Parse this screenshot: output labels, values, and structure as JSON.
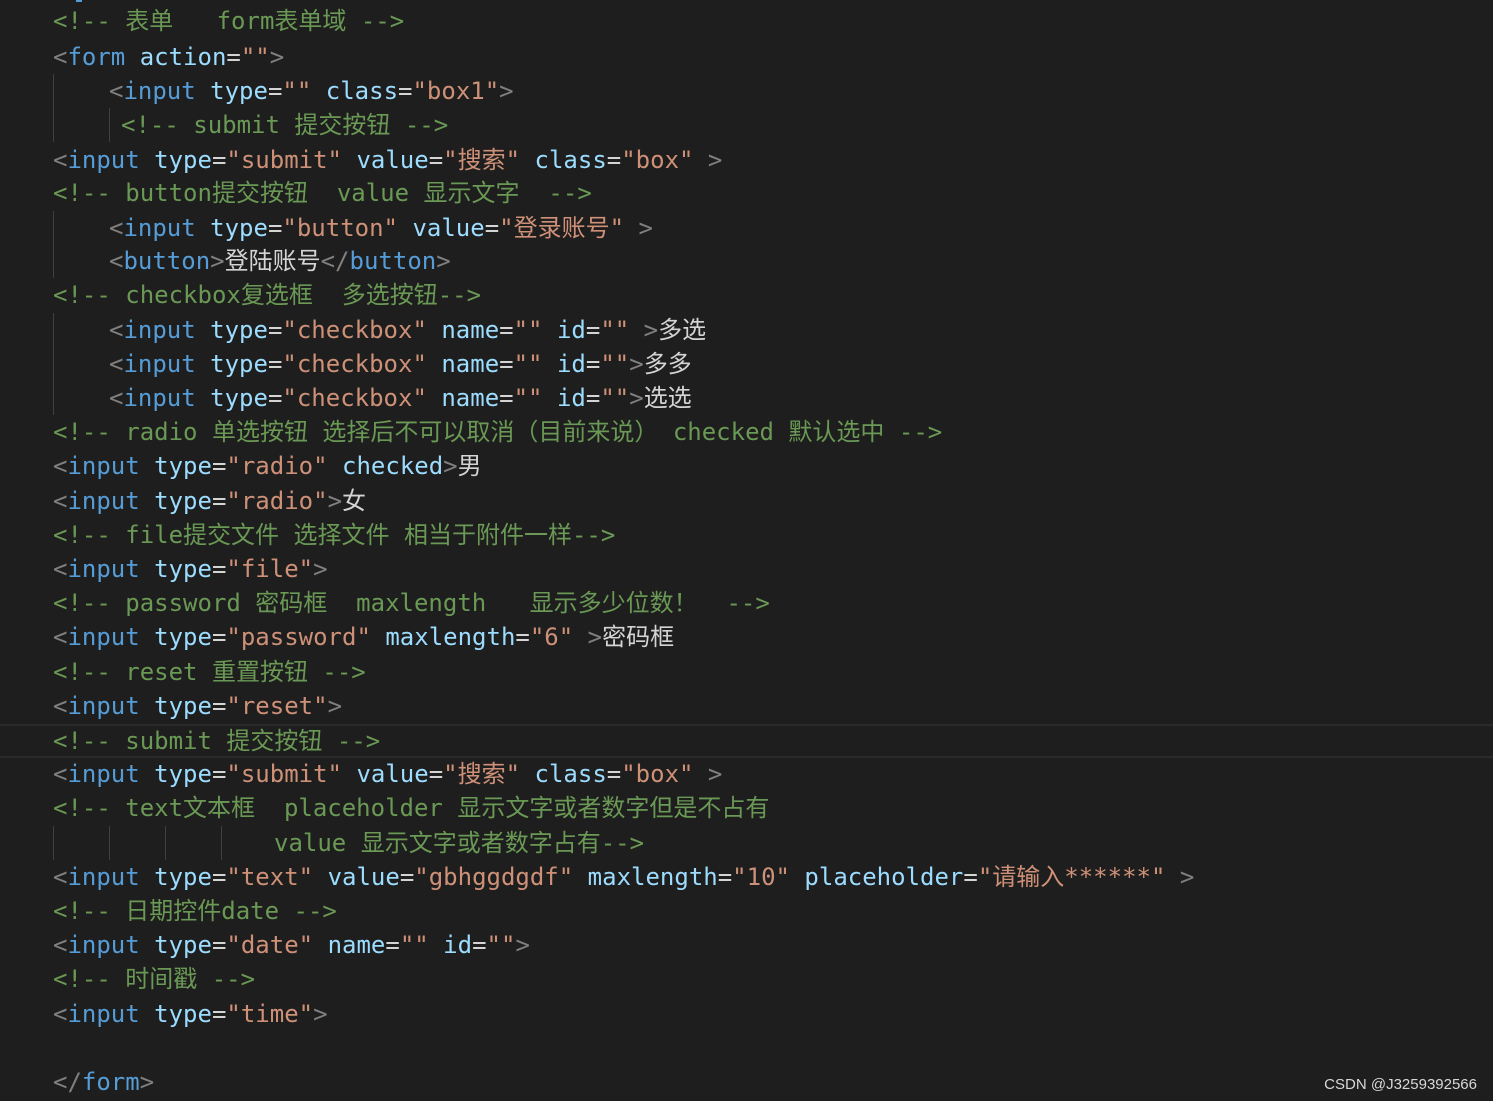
{
  "editor": {
    "language": "html",
    "lines": [
      {
        "tokens": [
          {
            "t": "<!-- 表单   form表单域 -->",
            "c": "com"
          }
        ]
      },
      {
        "tokens": [
          {
            "t": "<",
            "c": "pun"
          },
          {
            "t": "form",
            "c": "tag"
          },
          {
            "t": " ",
            "c": "txt"
          },
          {
            "t": "action",
            "c": "attr"
          },
          {
            "t": "=",
            "c": "eq"
          },
          {
            "t": "\"\"",
            "c": "str"
          },
          {
            "t": ">",
            "c": "pun"
          }
        ]
      },
      {
        "tokens": [
          {
            "t": "<",
            "c": "pun"
          },
          {
            "t": "input",
            "c": "tag"
          },
          {
            "t": " ",
            "c": "txt"
          },
          {
            "t": "type",
            "c": "attr"
          },
          {
            "t": "=",
            "c": "eq"
          },
          {
            "t": "\"\"",
            "c": "str"
          },
          {
            "t": " ",
            "c": "txt"
          },
          {
            "t": "class",
            "c": "attr"
          },
          {
            "t": "=",
            "c": "eq"
          },
          {
            "t": "\"box1\"",
            "c": "str"
          },
          {
            "t": ">",
            "c": "pun"
          }
        ]
      },
      {
        "tokens": [
          {
            "t": "<!-- submit 提交按钮 -->",
            "c": "com"
          }
        ]
      },
      {
        "tokens": [
          {
            "t": "<",
            "c": "pun"
          },
          {
            "t": "input",
            "c": "tag"
          },
          {
            "t": " ",
            "c": "txt"
          },
          {
            "t": "type",
            "c": "attr"
          },
          {
            "t": "=",
            "c": "eq"
          },
          {
            "t": "\"submit\"",
            "c": "str"
          },
          {
            "t": " ",
            "c": "txt"
          },
          {
            "t": "value",
            "c": "attr"
          },
          {
            "t": "=",
            "c": "eq"
          },
          {
            "t": "\"搜索\"",
            "c": "str"
          },
          {
            "t": " ",
            "c": "txt"
          },
          {
            "t": "class",
            "c": "attr"
          },
          {
            "t": "=",
            "c": "eq"
          },
          {
            "t": "\"box\"",
            "c": "str"
          },
          {
            "t": " >",
            "c": "pun"
          }
        ]
      },
      {
        "tokens": [
          {
            "t": "<!-- button提交按钮  value 显示文字  -->",
            "c": "com"
          }
        ]
      },
      {
        "tokens": [
          {
            "t": "<",
            "c": "pun"
          },
          {
            "t": "input",
            "c": "tag"
          },
          {
            "t": " ",
            "c": "txt"
          },
          {
            "t": "type",
            "c": "attr"
          },
          {
            "t": "=",
            "c": "eq"
          },
          {
            "t": "\"button\"",
            "c": "str"
          },
          {
            "t": " ",
            "c": "txt"
          },
          {
            "t": "value",
            "c": "attr"
          },
          {
            "t": "=",
            "c": "eq"
          },
          {
            "t": "\"登录账号\"",
            "c": "str"
          },
          {
            "t": " >",
            "c": "pun"
          }
        ]
      },
      {
        "tokens": [
          {
            "t": "<",
            "c": "pun"
          },
          {
            "t": "button",
            "c": "tag"
          },
          {
            "t": ">",
            "c": "pun"
          },
          {
            "t": "登陆账号",
            "c": "txt"
          },
          {
            "t": "</",
            "c": "pun"
          },
          {
            "t": "button",
            "c": "tag"
          },
          {
            "t": ">",
            "c": "pun"
          }
        ]
      },
      {
        "tokens": [
          {
            "t": "<!-- checkbox复选框  多选按钮-->",
            "c": "com"
          }
        ]
      },
      {
        "tokens": [
          {
            "t": "<",
            "c": "pun"
          },
          {
            "t": "input",
            "c": "tag"
          },
          {
            "t": " ",
            "c": "txt"
          },
          {
            "t": "type",
            "c": "attr"
          },
          {
            "t": "=",
            "c": "eq"
          },
          {
            "t": "\"checkbox\"",
            "c": "str"
          },
          {
            "t": " ",
            "c": "txt"
          },
          {
            "t": "name",
            "c": "attr"
          },
          {
            "t": "=",
            "c": "eq"
          },
          {
            "t": "\"\"",
            "c": "str"
          },
          {
            "t": " ",
            "c": "txt"
          },
          {
            "t": "id",
            "c": "attr"
          },
          {
            "t": "=",
            "c": "eq"
          },
          {
            "t": "\"\"",
            "c": "str"
          },
          {
            "t": " >",
            "c": "pun"
          },
          {
            "t": "多选",
            "c": "txt"
          }
        ]
      },
      {
        "tokens": [
          {
            "t": "<",
            "c": "pun"
          },
          {
            "t": "input",
            "c": "tag"
          },
          {
            "t": " ",
            "c": "txt"
          },
          {
            "t": "type",
            "c": "attr"
          },
          {
            "t": "=",
            "c": "eq"
          },
          {
            "t": "\"checkbox\"",
            "c": "str"
          },
          {
            "t": " ",
            "c": "txt"
          },
          {
            "t": "name",
            "c": "attr"
          },
          {
            "t": "=",
            "c": "eq"
          },
          {
            "t": "\"\"",
            "c": "str"
          },
          {
            "t": " ",
            "c": "txt"
          },
          {
            "t": "id",
            "c": "attr"
          },
          {
            "t": "=",
            "c": "eq"
          },
          {
            "t": "\"\"",
            "c": "str"
          },
          {
            "t": ">",
            "c": "pun"
          },
          {
            "t": "多多",
            "c": "txt"
          }
        ]
      },
      {
        "tokens": [
          {
            "t": "<",
            "c": "pun"
          },
          {
            "t": "input",
            "c": "tag"
          },
          {
            "t": " ",
            "c": "txt"
          },
          {
            "t": "type",
            "c": "attr"
          },
          {
            "t": "=",
            "c": "eq"
          },
          {
            "t": "\"checkbox\"",
            "c": "str"
          },
          {
            "t": " ",
            "c": "txt"
          },
          {
            "t": "name",
            "c": "attr"
          },
          {
            "t": "=",
            "c": "eq"
          },
          {
            "t": "\"\"",
            "c": "str"
          },
          {
            "t": " ",
            "c": "txt"
          },
          {
            "t": "id",
            "c": "attr"
          },
          {
            "t": "=",
            "c": "eq"
          },
          {
            "t": "\"\"",
            "c": "str"
          },
          {
            "t": ">",
            "c": "pun"
          },
          {
            "t": "选选",
            "c": "txt"
          }
        ]
      },
      {
        "tokens": [
          {
            "t": "<!-- radio 单选按钮 选择后不可以取消（目前来说） checked 默认选中 -->",
            "c": "com"
          }
        ]
      },
      {
        "tokens": [
          {
            "t": "<",
            "c": "pun"
          },
          {
            "t": "input",
            "c": "tag"
          },
          {
            "t": " ",
            "c": "txt"
          },
          {
            "t": "type",
            "c": "attr"
          },
          {
            "t": "=",
            "c": "eq"
          },
          {
            "t": "\"radio\"",
            "c": "str"
          },
          {
            "t": " ",
            "c": "txt"
          },
          {
            "t": "checked",
            "c": "attr"
          },
          {
            "t": ">",
            "c": "pun"
          },
          {
            "t": "男",
            "c": "txt"
          }
        ]
      },
      {
        "tokens": [
          {
            "t": "<",
            "c": "pun"
          },
          {
            "t": "input",
            "c": "tag"
          },
          {
            "t": " ",
            "c": "txt"
          },
          {
            "t": "type",
            "c": "attr"
          },
          {
            "t": "=",
            "c": "eq"
          },
          {
            "t": "\"radio\"",
            "c": "str"
          },
          {
            "t": ">",
            "c": "pun"
          },
          {
            "t": "女",
            "c": "txt"
          }
        ]
      },
      {
        "tokens": [
          {
            "t": "<!-- file提交文件 选择文件 相当于附件一样-->",
            "c": "com"
          }
        ]
      },
      {
        "tokens": [
          {
            "t": "<",
            "c": "pun"
          },
          {
            "t": "input",
            "c": "tag"
          },
          {
            "t": " ",
            "c": "txt"
          },
          {
            "t": "type",
            "c": "attr"
          },
          {
            "t": "=",
            "c": "eq"
          },
          {
            "t": "\"file\"",
            "c": "str"
          },
          {
            "t": ">",
            "c": "pun"
          }
        ]
      },
      {
        "tokens": [
          {
            "t": "<!-- password 密码框  maxlength   显示多少位数！  -->",
            "c": "com"
          }
        ]
      },
      {
        "tokens": [
          {
            "t": "<",
            "c": "pun"
          },
          {
            "t": "input",
            "c": "tag"
          },
          {
            "t": " ",
            "c": "txt"
          },
          {
            "t": "type",
            "c": "attr"
          },
          {
            "t": "=",
            "c": "eq"
          },
          {
            "t": "\"password\"",
            "c": "str"
          },
          {
            "t": " ",
            "c": "txt"
          },
          {
            "t": "maxlength",
            "c": "attr"
          },
          {
            "t": "=",
            "c": "eq"
          },
          {
            "t": "\"6\"",
            "c": "str"
          },
          {
            "t": " >",
            "c": "pun"
          },
          {
            "t": "密码框",
            "c": "txt"
          }
        ]
      },
      {
        "tokens": [
          {
            "t": "<!-- reset 重置按钮 -->",
            "c": "com"
          }
        ]
      },
      {
        "tokens": [
          {
            "t": "<",
            "c": "pun"
          },
          {
            "t": "input",
            "c": "tag"
          },
          {
            "t": " ",
            "c": "txt"
          },
          {
            "t": "type",
            "c": "attr"
          },
          {
            "t": "=",
            "c": "eq"
          },
          {
            "t": "\"reset\"",
            "c": "str"
          },
          {
            "t": ">",
            "c": "pun"
          }
        ]
      },
      {
        "tokens": [
          {
            "t": "<!-- submit 提交按钮 -->",
            "c": "com"
          }
        ]
      },
      {
        "tokens": [
          {
            "t": "<",
            "c": "pun"
          },
          {
            "t": "input",
            "c": "tag"
          },
          {
            "t": " ",
            "c": "txt"
          },
          {
            "t": "type",
            "c": "attr"
          },
          {
            "t": "=",
            "c": "eq"
          },
          {
            "t": "\"submit\"",
            "c": "str"
          },
          {
            "t": " ",
            "c": "txt"
          },
          {
            "t": "value",
            "c": "attr"
          },
          {
            "t": "=",
            "c": "eq"
          },
          {
            "t": "\"搜索\"",
            "c": "str"
          },
          {
            "t": " ",
            "c": "txt"
          },
          {
            "t": "class",
            "c": "attr"
          },
          {
            "t": "=",
            "c": "eq"
          },
          {
            "t": "\"box\"",
            "c": "str"
          },
          {
            "t": " >",
            "c": "pun"
          }
        ]
      },
      {
        "tokens": [
          {
            "t": "<!-- text文本框  placeholder 显示文字或者数字但是不占有",
            "c": "com"
          }
        ]
      },
      {
        "tokens": [
          {
            "t": "value 显示文字或者数字占有-->",
            "c": "com"
          }
        ]
      },
      {
        "tokens": [
          {
            "t": "<",
            "c": "pun"
          },
          {
            "t": "input",
            "c": "tag"
          },
          {
            "t": " ",
            "c": "txt"
          },
          {
            "t": "type",
            "c": "attr"
          },
          {
            "t": "=",
            "c": "eq"
          },
          {
            "t": "\"text\"",
            "c": "str"
          },
          {
            "t": " ",
            "c": "txt"
          },
          {
            "t": "value",
            "c": "attr"
          },
          {
            "t": "=",
            "c": "eq"
          },
          {
            "t": "\"gbhggdgdf\"",
            "c": "str"
          },
          {
            "t": " ",
            "c": "txt"
          },
          {
            "t": "maxlength",
            "c": "attr"
          },
          {
            "t": "=",
            "c": "eq"
          },
          {
            "t": "\"10\"",
            "c": "str"
          },
          {
            "t": " ",
            "c": "txt"
          },
          {
            "t": "placeholder",
            "c": "attr"
          },
          {
            "t": "=",
            "c": "eq"
          },
          {
            "t": "\"请输入******\"",
            "c": "str"
          },
          {
            "t": " >",
            "c": "pun"
          }
        ]
      },
      {
        "tokens": [
          {
            "t": "<!-- 日期控件date -->",
            "c": "com"
          }
        ]
      },
      {
        "tokens": [
          {
            "t": "<",
            "c": "pun"
          },
          {
            "t": "input",
            "c": "tag"
          },
          {
            "t": " ",
            "c": "txt"
          },
          {
            "t": "type",
            "c": "attr"
          },
          {
            "t": "=",
            "c": "eq"
          },
          {
            "t": "\"date\"",
            "c": "str"
          },
          {
            "t": " ",
            "c": "txt"
          },
          {
            "t": "name",
            "c": "attr"
          },
          {
            "t": "=",
            "c": "eq"
          },
          {
            "t": "\"\"",
            "c": "str"
          },
          {
            "t": " ",
            "c": "txt"
          },
          {
            "t": "id",
            "c": "attr"
          },
          {
            "t": "=",
            "c": "eq"
          },
          {
            "t": "\"\"",
            "c": "str"
          },
          {
            "t": ">",
            "c": "pun"
          }
        ]
      },
      {
        "tokens": [
          {
            "t": "<!-- 时间戳 -->",
            "c": "com"
          }
        ]
      },
      {
        "tokens": [
          {
            "t": "<",
            "c": "pun"
          },
          {
            "t": "input",
            "c": "tag"
          },
          {
            "t": " ",
            "c": "txt"
          },
          {
            "t": "type",
            "c": "attr"
          },
          {
            "t": "=",
            "c": "eq"
          },
          {
            "t": "\"time\"",
            "c": "str"
          },
          {
            "t": ">",
            "c": "pun"
          }
        ]
      },
      {
        "tokens": []
      },
      {
        "tokens": [
          {
            "t": "</",
            "c": "pun"
          },
          {
            "t": "form",
            "c": "tag"
          },
          {
            "t": ">",
            "c": "pun"
          }
        ]
      }
    ]
  },
  "watermark": {
    "text": "CSDN @J3259392566"
  },
  "colors": {
    "background": "#1e1e1e",
    "comment": "#6a9955",
    "tag": "#569cd6",
    "attribute": "#9cdcfe",
    "string": "#ce9178",
    "punctuation": "#808080",
    "text": "#d4d4d4"
  }
}
